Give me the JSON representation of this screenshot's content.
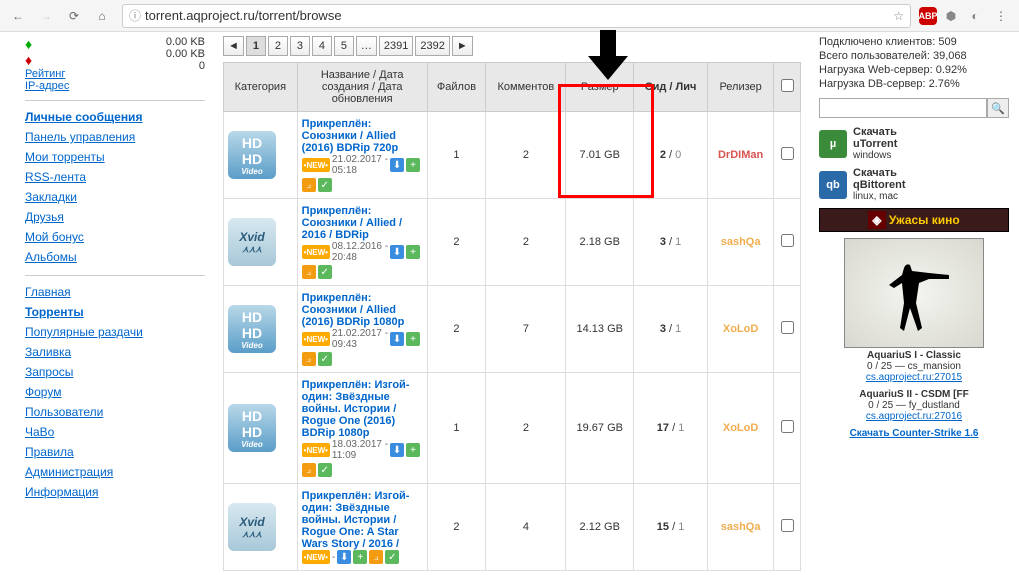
{
  "browser": {
    "url": "torrent.aqproject.ru/torrent/browse"
  },
  "stats": {
    "up_kb": "0.00 KB",
    "down_kb": "0.00 KB",
    "rating_label": "Рейтинг",
    "rating_val": "0",
    "ip_label": "IP-адрес"
  },
  "menu1": [
    "Личные сообщения",
    "Панель управления",
    "Мои торренты",
    "RSS-лента",
    "Закладки",
    "Друзья",
    "Мой бонус",
    "Альбомы"
  ],
  "menu2": [
    "Главная",
    "Торренты",
    "Популярные раздачи",
    "Заливка",
    "Запросы",
    "Форум",
    "Пользователи",
    "ЧаВо",
    "Правила",
    "Администрация",
    "Информация"
  ],
  "pager": [
    "1",
    "2",
    "3",
    "4",
    "5",
    "…",
    "2391",
    "2392"
  ],
  "headers": {
    "cat": "Категория",
    "name": "Название / Дата создания / Дата обновления",
    "files": "Файлов",
    "comments": "Комментов",
    "size": "Размер",
    "seed_leech": "Сид / Лич",
    "releaser": "Релизер"
  },
  "rows": [
    {
      "cat": "hd",
      "pin": "Прикреплён:",
      "title": "Союзники / Allied (2016) BDRip 720p",
      "date": "21.02.2017 - 05:18",
      "files": "1",
      "comments": "2",
      "size": "7.01 GB",
      "seed": "2",
      "leech": "0",
      "rel": "DrDIMan",
      "rc": "red"
    },
    {
      "cat": "xvid",
      "pin": "Прикреплён:",
      "title": "Союзники / Allied / 2016 / BDRip",
      "date": "08.12.2016 - 20:48",
      "files": "2",
      "comments": "2",
      "size": "2.18 GB",
      "seed": "3",
      "leech": "1",
      "rel": "sashQa",
      "rc": "orange"
    },
    {
      "cat": "hd",
      "pin": "Прикреплён:",
      "title": "Союзники / Allied (2016) BDRip 1080p",
      "date": "21.02.2017 - 09:43",
      "files": "2",
      "comments": "7",
      "size": "14.13 GB",
      "seed": "3",
      "leech": "1",
      "rel": "XoLoD",
      "rc": "orange"
    },
    {
      "cat": "hd",
      "pin": "Прикреплён:",
      "title": "Изгой-один: Звёздные войны. Истории / Rogue One (2016) BDRip 1080p",
      "date": "18.03.2017 - 11:09",
      "files": "1",
      "comments": "2",
      "size": "19.67 GB",
      "seed": "17",
      "leech": "1",
      "rel": "XoLoD",
      "rc": "orange"
    },
    {
      "cat": "xvid",
      "pin": "Прикреплён:",
      "title": "Изгой-один: Звёздные войны. Истории / Rogue One: A Star Wars Story / 2016 /",
      "date": "",
      "files": "2",
      "comments": "4",
      "size": "2.12 GB",
      "seed": "15",
      "leech": "1",
      "rel": "sashQa",
      "rc": "orange"
    }
  ],
  "right": {
    "clients": "Подключено клиентов: 509",
    "users": "Всего пользователей: 39,068",
    "web_load": "Нагрузка Web-сервер: 0.92%",
    "db_load": "Нагрузка DB-сервер: 2.76%",
    "utorrent": {
      "b": "Скачать",
      "n": "uTorrent",
      "s": "windows"
    },
    "qbit": {
      "b": "Скачать",
      "n": "qBittorent",
      "s": "linux, mac"
    },
    "horror": "Ужасы кино",
    "cs1": {
      "name": "AquariuS I - Classic",
      "slots": "0 / 25 — cs_mansion",
      "link": "cs.aqproject.ru:27015"
    },
    "cs2": {
      "name": "AquariuS II - CSDM [FF",
      "slots": "0 / 25 — fy_dustland",
      "link": "cs.aqproject.ru:27016"
    },
    "cs_dl": "Скачать Counter-Strike 1.6"
  }
}
